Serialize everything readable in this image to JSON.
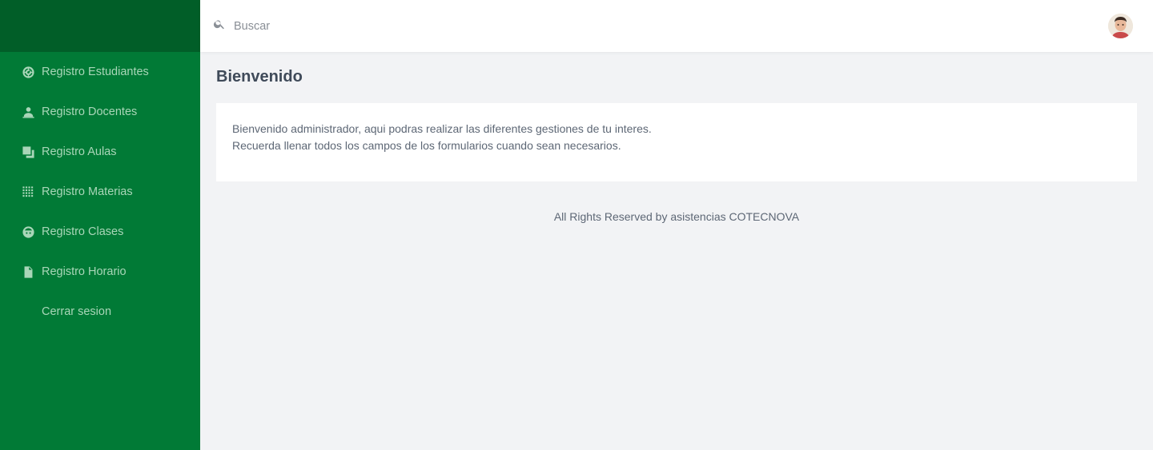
{
  "sidebar": {
    "items": [
      {
        "label": "Registro Estudiantes",
        "icon": "gauge-icon"
      },
      {
        "label": "Registro Docentes",
        "icon": "user-icon"
      },
      {
        "label": "Registro Aulas",
        "icon": "copy-icon"
      },
      {
        "label": "Registro Materias",
        "icon": "grid-icon"
      },
      {
        "label": "Registro Clases",
        "icon": "face-icon"
      },
      {
        "label": "Registro Horario",
        "icon": "file-icon"
      },
      {
        "label": "Cerrar sesion",
        "icon": ""
      }
    ]
  },
  "topbar": {
    "search_placeholder": "Buscar"
  },
  "main": {
    "title": "Bienvenido",
    "card_line1": "Bienvenido administrador, aqui podras realizar las diferentes gestiones de tu interes.",
    "card_line2": "Recuerda llenar todos los campos de los formularios cuando sean necesarios."
  },
  "footer": {
    "text": "All Rights Reserved by asistencias COTECNOVA"
  },
  "colors": {
    "sidebar": "#017a36",
    "sidebar_brand": "#015e28",
    "sidebar_text": "#a9d6b8",
    "background": "#f2f3f5"
  }
}
